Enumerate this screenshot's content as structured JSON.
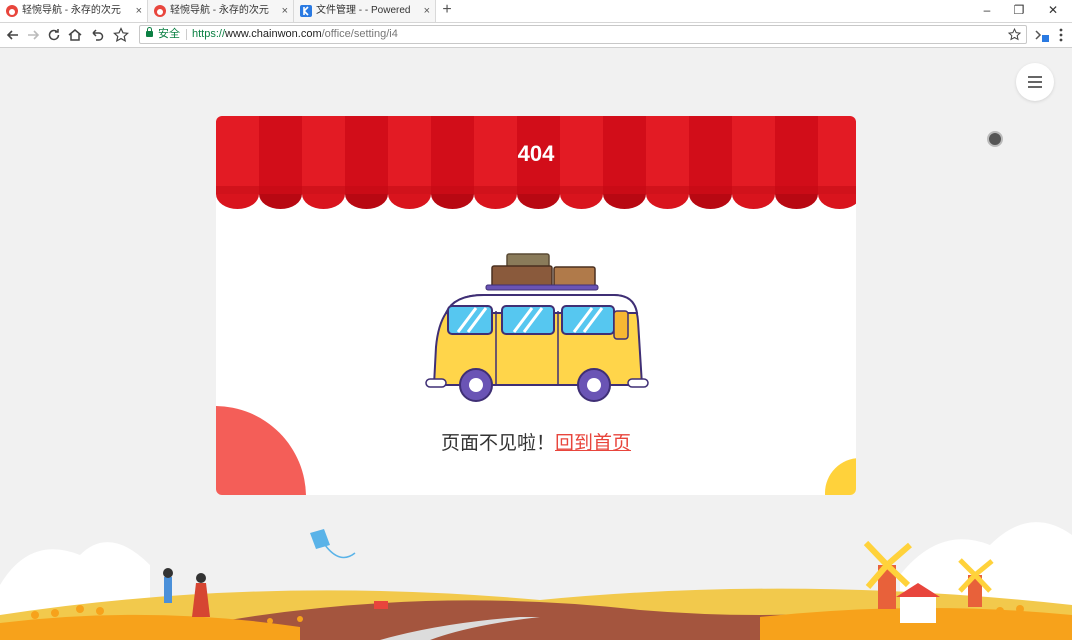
{
  "browser": {
    "tabs": [
      {
        "title": "轻惋导航 - 永存的次元",
        "active": true,
        "icon": "weibo-like-icon"
      },
      {
        "title": "轻惋导航 - 永存的次元",
        "active": false,
        "icon": "weibo-like-icon"
      },
      {
        "title": "文件管理 - - Powered",
        "active": false,
        "icon": "k-logo-icon"
      }
    ],
    "close_glyph": "×",
    "new_tab_glyph": "+",
    "window_controls": {
      "minimize": "–",
      "restore": "❐",
      "close": "✕"
    },
    "security_label": "安全",
    "url_scheme": "https://",
    "url_host": "www.chainwon.com",
    "url_path": "/office/setting/i4"
  },
  "page": {
    "error_code": "404",
    "message": "页面不见啦！",
    "home_link": "回到首页"
  },
  "colors": {
    "awning_light": "#e31b24",
    "awning_dark": "#d20d19",
    "accent_link": "#e8453c",
    "blob_red": "#f45e58",
    "blob_yellow": "#ffd23b",
    "bus_body": "#ffd54a"
  }
}
